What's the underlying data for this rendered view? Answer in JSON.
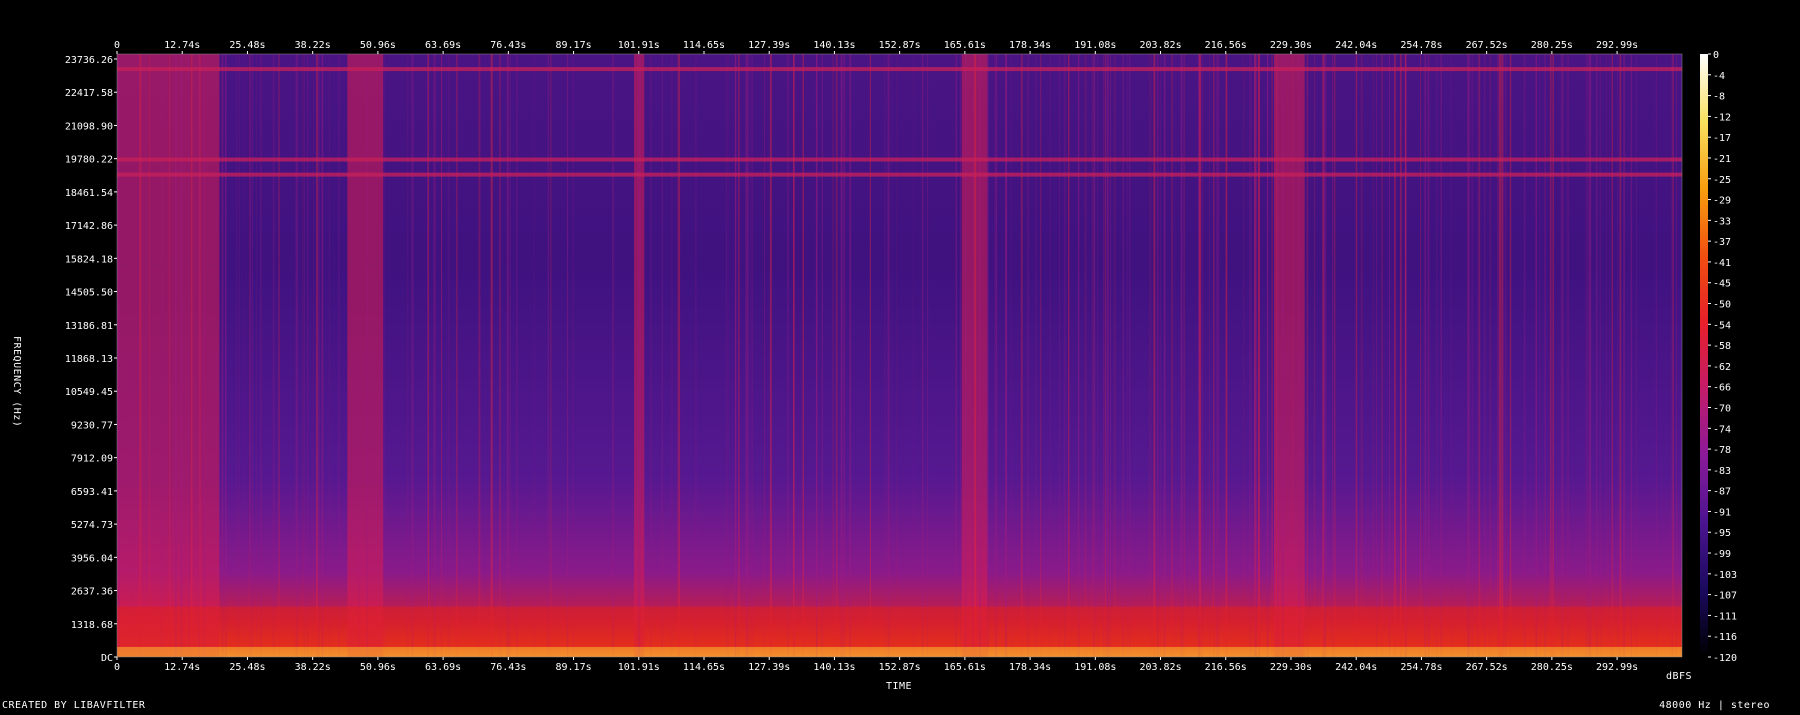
{
  "footer": {
    "credit": "CREATED BY LIBAVFILTER",
    "format": "48000 Hz | stereo"
  },
  "chart_data": {
    "type": "heatmap",
    "title": "",
    "xlabel": "TIME",
    "ylabel": "FREQUENCY (Hz)",
    "x_ticks": [
      "0",
      "12.74s",
      "25.48s",
      "38.22s",
      "50.96s",
      "63.69s",
      "76.43s",
      "89.17s",
      "101.91s",
      "114.65s",
      "127.39s",
      "140.13s",
      "152.87s",
      "165.61s",
      "178.34s",
      "191.08s",
      "203.82s",
      "216.56s",
      "229.30s",
      "242.04s",
      "254.78s",
      "267.52s",
      "280.25s",
      "292.99s"
    ],
    "xlim": [
      0,
      305.7
    ],
    "y_ticks": [
      "23736.26",
      "22417.58",
      "21098.90",
      "19780.22",
      "18461.54",
      "17142.86",
      "15824.18",
      "14505.50",
      "13186.81",
      "11868.13",
      "10549.45",
      "9230.77",
      "7912.09",
      "6593.41",
      "5274.73",
      "3956.04",
      "2637.36",
      "1318.68",
      "DC"
    ],
    "ylim": [
      0,
      24000
    ],
    "colorbar": {
      "unit": "dBFS",
      "range": [
        -120,
        0
      ],
      "ticks": [
        "0",
        "-4",
        "-8",
        "-12",
        "-17",
        "-21",
        "-25",
        "-29",
        "-33",
        "-37",
        "-41",
        "-45",
        "-50",
        "-54",
        "-58",
        "-62",
        "-66",
        "-70",
        "-74",
        "-78",
        "-83",
        "-87",
        "-91",
        "-95",
        "-99",
        "-103",
        "-107",
        "-111",
        "-116",
        "-120"
      ],
      "colors": [
        "#000000",
        "#1a0a5e",
        "#4b1490",
        "#8a1a9a",
        "#c41c6a",
        "#e8202a",
        "#f05010",
        "#f8a010",
        "#f8e060",
        "#ffffff"
      ]
    },
    "louder_time_regions": [
      {
        "from": 0,
        "to": 20
      },
      {
        "from": 45,
        "to": 52
      },
      {
        "from": 101,
        "to": 103
      },
      {
        "from": 165,
        "to": 170
      },
      {
        "from": 226,
        "to": 232
      }
    ],
    "horizontal_bands_hz": [
      23400,
      19800,
      19200
    ],
    "grid": false,
    "legend": "colorbar-right"
  }
}
